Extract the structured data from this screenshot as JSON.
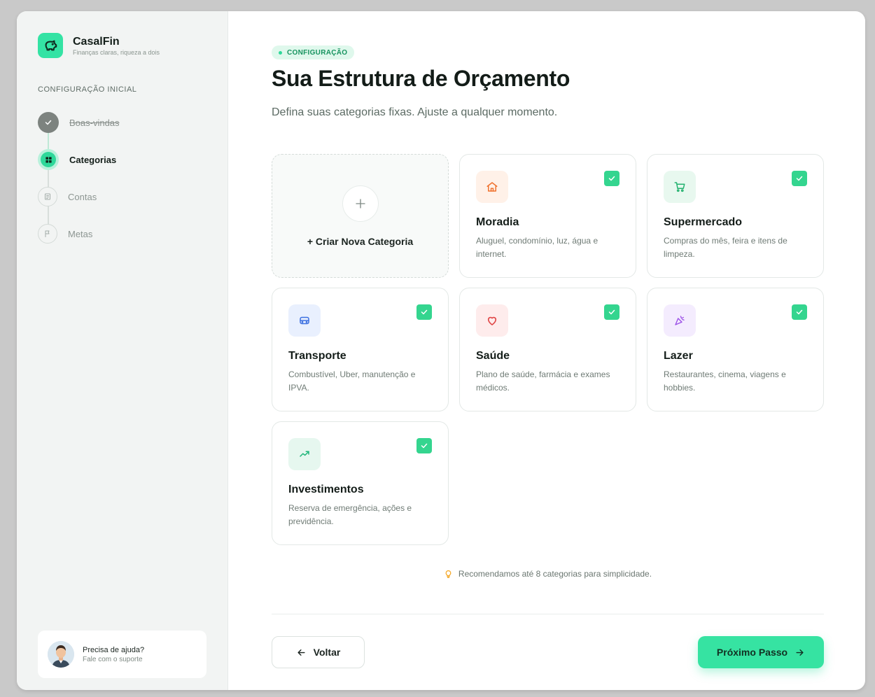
{
  "brand": {
    "name": "CasalFin",
    "tagline": "Finanças claras, riqueza a dois"
  },
  "sidebar": {
    "section_label": "CONFIGURAÇÃO INICIAL",
    "steps": [
      {
        "label": "Boas-vindas",
        "state": "done",
        "icon": "check-icon"
      },
      {
        "label": "Categorias",
        "state": "active",
        "icon": "grid-icon"
      },
      {
        "label": "Contas",
        "state": "idle",
        "icon": "bank-icon"
      },
      {
        "label": "Metas",
        "state": "idle",
        "icon": "flag-icon"
      }
    ],
    "help": {
      "title": "Precisa de ajuda?",
      "subtitle": "Fale com o suporte"
    }
  },
  "main": {
    "badge": "CONFIGURAÇÃO",
    "title": "Sua Estrutura de Orçamento",
    "subtitle": "Defina suas categorias fixas. Ajuste a qualquer momento.",
    "create_card": {
      "icon": "plus-icon",
      "label": "+ Criar Nova Categoria"
    },
    "categories": [
      {
        "name": "Moradia",
        "description": "Aluguel, condomínio, luz, água e internet.",
        "icon": "home-icon",
        "icon_color": "#f0722e",
        "icon_bg": "#fff1e8",
        "checked": true
      },
      {
        "name": "Supermercado",
        "description": "Compras do mês, feira e itens de limpeza.",
        "icon": "cart-icon",
        "icon_color": "#23b26f",
        "icon_bg": "#e8f8ef",
        "checked": true
      },
      {
        "name": "Transporte",
        "description": "Combustível, Uber, manutenção e IPVA.",
        "icon": "car-icon",
        "icon_color": "#3b6fe0",
        "icon_bg": "#e9f0fe",
        "checked": true
      },
      {
        "name": "Saúde",
        "description": "Plano de saúde, farmácia e exames médicos.",
        "icon": "heart-icon",
        "icon_color": "#e04848",
        "icon_bg": "#feecec",
        "checked": true
      },
      {
        "name": "Lazer",
        "description": "Restaurantes, cinema, viagens e hobbies.",
        "icon": "party-icon",
        "icon_color": "#9b4fe6",
        "icon_bg": "#f4ecfe",
        "checked": true
      },
      {
        "name": "Investimentos",
        "description": "Reserva de emergência, ações e previdência.",
        "icon": "trending-up-icon",
        "icon_color": "#1fb57a",
        "icon_bg": "#e6f7ef",
        "checked": true
      }
    ],
    "tip": "Recomendamos até 8 categorias para simplicidade.",
    "back_label": "Voltar",
    "next_label": "Próximo Passo"
  },
  "colors": {
    "accent": "#36e3a2",
    "check": "#34d58f",
    "sidebar_bg": "#f2f4f3"
  }
}
